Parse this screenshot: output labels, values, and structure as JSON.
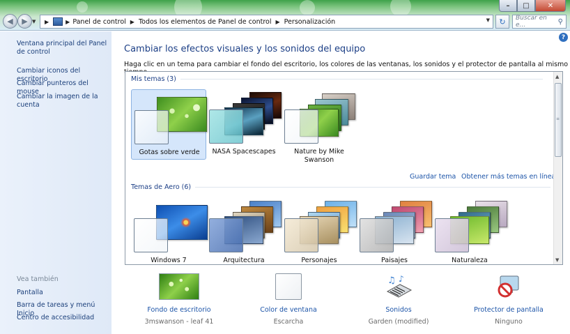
{
  "address_bar": {
    "crumbs": [
      "Panel de control",
      "Todos los elementos de Panel de control",
      "Personalización"
    ],
    "search_placeholder": "Buscar en e..."
  },
  "sidebar": {
    "main_link": "Ventana principal del Panel de control",
    "links": [
      "Cambiar iconos del escritorio",
      "Cambiar punteros del mouse",
      "Cambiar la imagen de la cuenta"
    ],
    "see_also_title": "Vea también",
    "see_also": [
      "Pantalla",
      "Barra de tareas y menú Inicio",
      "Centro de accesibilidad"
    ]
  },
  "main": {
    "title": "Cambiar los efectos visuales y los sonidos del equipo",
    "subtitle": "Haga clic en un tema para cambiar el fondo del escritorio, los colores de las ventanas, los sonidos y el protector de pantalla al mismo tiempo.",
    "my_themes_title": "Mis temas (3)",
    "my_themes": [
      {
        "name": "Gotas sobre verde",
        "selected": true
      },
      {
        "name": "NASA Spacescapes",
        "selected": false
      },
      {
        "name": "Nature by Mike Swanson",
        "selected": false
      }
    ],
    "save_theme": "Guardar tema",
    "more_themes": "Obtener más temas en línea",
    "aero_themes_title": "Temas de Aero (6)",
    "aero_themes": [
      {
        "name": "Windows 7"
      },
      {
        "name": "Arquitectura"
      },
      {
        "name": "Personajes"
      },
      {
        "name": "Paisajes"
      },
      {
        "name": "Naturaleza"
      }
    ]
  },
  "bottom": [
    {
      "label": "Fondo de escritorio",
      "value": "3mswanson - leaf 41",
      "icon": "desktop-background-icon"
    },
    {
      "label": "Color de ventana",
      "value": "Escarcha",
      "icon": "window-color-icon"
    },
    {
      "label": "Sonidos",
      "value": "Garden (modified)",
      "icon": "sounds-icon"
    },
    {
      "label": "Protector de pantalla",
      "value": "Ninguno",
      "icon": "screensaver-icon"
    }
  ],
  "colors": {
    "link": "#1c54a8",
    "title": "#1c3f86",
    "sidebar_bg": "#e4edf9",
    "selected_bg": "#d5e6fb"
  }
}
